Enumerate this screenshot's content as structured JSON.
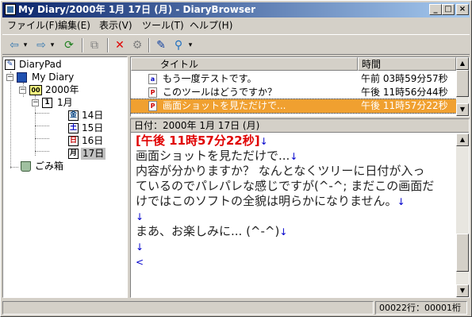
{
  "window": {
    "title": "My Diary/2000年 1月 17日 (月) - DiaryBrowser",
    "min_glyph": "_",
    "max_glyph": "□",
    "close_glyph": "×"
  },
  "menu": [
    "ファイル(F)",
    "編集(E)",
    "表示(V)",
    "ツール(T)",
    "ヘルプ(H)"
  ],
  "toolbar_icons": [
    "back-arrow-icon",
    "forward-arrow-icon",
    "refresh-icon",
    "copy-icon",
    "delete-icon",
    "properties-icon",
    "edit-pen-icon",
    "search-icon"
  ],
  "toolbar_glyphs": {
    "back": "⇦",
    "back_drop": "▾",
    "forward": "⇨",
    "forward_drop": "▾",
    "refresh": "⟳",
    "copy": "⧉",
    "delete": "✕",
    "properties": "⚙",
    "edit": "✎",
    "search": "⚲",
    "search_drop": "▾"
  },
  "tree": {
    "root": "DiaryPad",
    "diary": "My Diary",
    "year": "2000年",
    "month": "1月",
    "days": [
      {
        "label": "14日",
        "icon_char": "金",
        "color": "#004080"
      },
      {
        "label": "15日",
        "icon_char": "土",
        "color": "#0000c0"
      },
      {
        "label": "16日",
        "icon_char": "日",
        "color": "#c00000"
      },
      {
        "label": "17日",
        "icon_char": "月",
        "color": "#000000"
      }
    ],
    "selected_day": "17日",
    "trash": "ごみ箱",
    "year_icon": "00",
    "month_icon": "1",
    "expand_minus": "−"
  },
  "list": {
    "columns": [
      "タイトル",
      "時間"
    ],
    "rows": [
      {
        "icon": "a",
        "title": "もう一度テストです。",
        "time": "午前 03時59分57秒"
      },
      {
        "icon": "P",
        "title": "このツールはどうですか？",
        "time": "午後 11時56分44秒"
      },
      {
        "icon": "P",
        "title": "画面ショットを見ただけで...",
        "time": "午後 11時57分22秒"
      }
    ],
    "selected_index": 2
  },
  "editor": {
    "date_label": "日付：2000年 1月 17日 (月)",
    "timestamp": "[午後 11時57分22秒]",
    "lines": [
      "画面ショットを見ただけで...",
      "内容が分かりますか？ なんとなくツリーに日付が入っ",
      "ているのでパレパレな感じですが(^-^; まだこの画面だ",
      "けではこのソフトの全貌は明らかになりません。",
      "",
      "まあ、お楽しみに... (^-^)",
      "",
      ""
    ],
    "return_mark": "↓",
    "eof_mark": "<",
    "scroll_up": "▲",
    "scroll_down": "▼"
  },
  "status": {
    "position": "00022行：00001桁"
  },
  "colors": {
    "title_gradient_start": "#0a246a",
    "selection_orange": "#f0a030",
    "timestamp_red": "#e00000"
  }
}
